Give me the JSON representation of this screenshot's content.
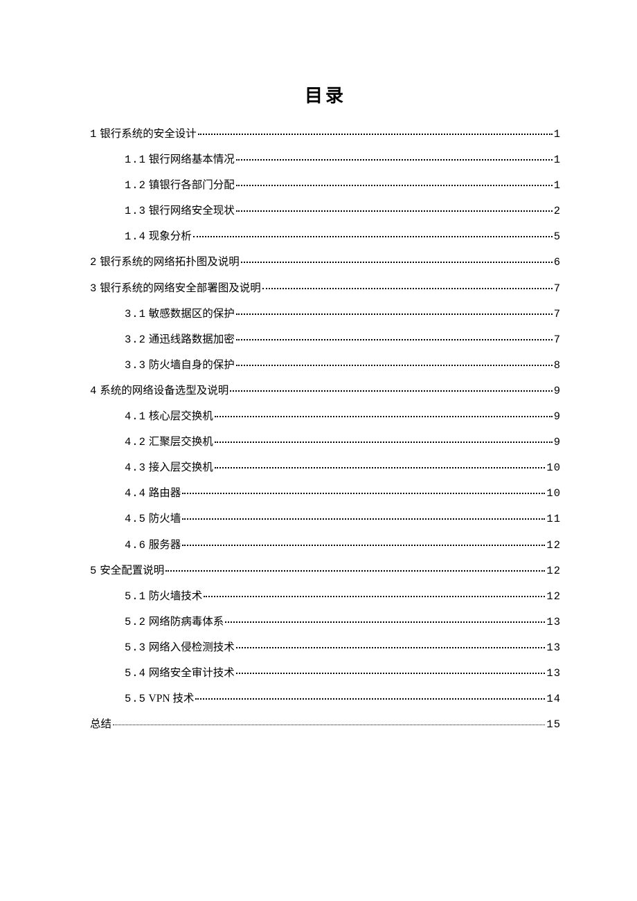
{
  "title": "目录",
  "toc": [
    {
      "level": 1,
      "num": "1",
      "title": "银行系统的安全设计",
      "page": "1"
    },
    {
      "level": 2,
      "num": "1.1",
      "title": "银行网络基本情况",
      "page": "1"
    },
    {
      "level": 2,
      "num": "1.2",
      "title": "镇银行各部门分配",
      "page": "1"
    },
    {
      "level": 2,
      "num": "1.3",
      "title": "银行网络安全现状",
      "page": "2"
    },
    {
      "level": 2,
      "num": "1.4",
      "title": "现象分析",
      "page": "5"
    },
    {
      "level": 1,
      "num": "2",
      "title": "银行系统的网络拓扑图及说明",
      "page": "6"
    },
    {
      "level": 1,
      "num": "3",
      "title": "银行系统的网络安全部署图及说明",
      "page": "7"
    },
    {
      "level": 2,
      "num": "3.1",
      "title": "敏感数据区的保护",
      "page": "7"
    },
    {
      "level": 2,
      "num": "3.2",
      "title": "通迅线路数据加密",
      "page": "7"
    },
    {
      "level": 2,
      "num": "3.3",
      "title": "防火墙自身的保护",
      "page": "8"
    },
    {
      "level": 1,
      "num": "4",
      "title": "系统的网络设备选型及说明",
      "page": "9"
    },
    {
      "level": 2,
      "num": "4.1",
      "title": "核心层交换机",
      "page": "9"
    },
    {
      "level": 2,
      "num": "4.2",
      "title": "汇聚层交换机",
      "page": "9"
    },
    {
      "level": 2,
      "num": "4.3",
      "title": "接入层交换机",
      "page": "10"
    },
    {
      "level": 2,
      "num": "4.4",
      "title": "路由器",
      "page": "10"
    },
    {
      "level": 2,
      "num": "4.5",
      "title": "防火墙",
      "page": "11"
    },
    {
      "level": 2,
      "num": "4.6",
      "title": "服务器",
      "page": "12"
    },
    {
      "level": 1,
      "num": "5",
      "title": "安全配置说明",
      "page": "12"
    },
    {
      "level": 2,
      "num": "5.1",
      "title": "防火墙技术",
      "page": "12"
    },
    {
      "level": 2,
      "num": "5.2",
      "title": "网络防病毒体系",
      "page": "13"
    },
    {
      "level": 2,
      "num": "5.3",
      "title": "网络入侵检测技术",
      "page": "13"
    },
    {
      "level": 2,
      "num": "5.4",
      "title": "网络安全审计技术",
      "page": "13"
    },
    {
      "level": 2,
      "num": "5.5",
      "title": "VPN 技术",
      "page": "14"
    },
    {
      "level": 1,
      "num": "",
      "title": "总结",
      "page": "15",
      "small": true
    }
  ]
}
